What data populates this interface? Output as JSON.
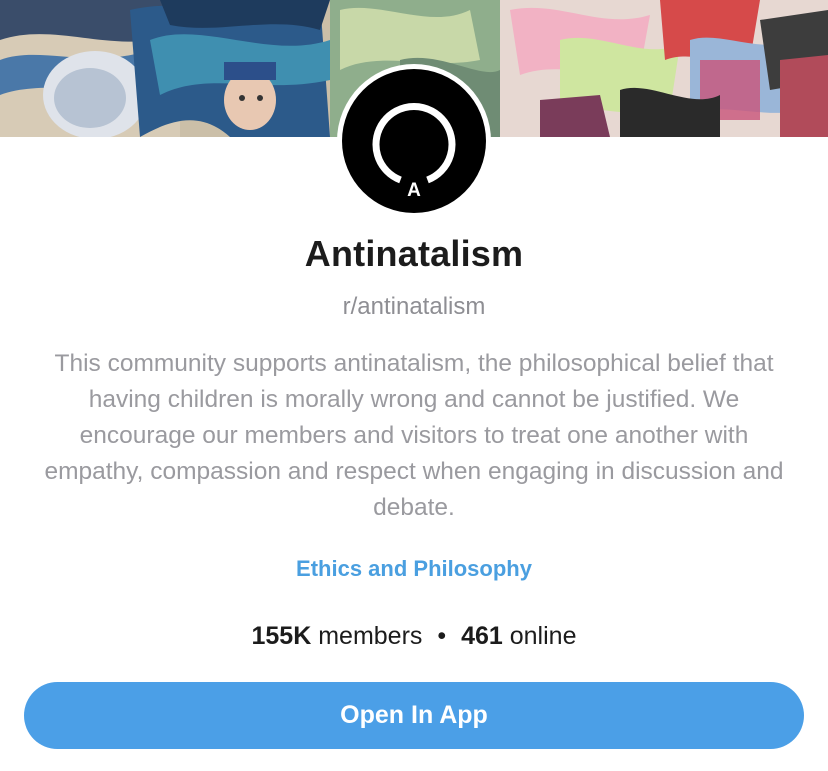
{
  "community": {
    "name": "Antinatalism",
    "handle": "r/antinatalism",
    "avatar_letter": "A",
    "description": "This community supports antinatalism, the philosophical belief that having children is morally wrong and cannot be justified. We encourage our members and visitors to treat one another with empathy, compassion and respect when engaging in discussion and debate.",
    "category": "Ethics and Philosophy",
    "members_count": "155K",
    "members_label": "members",
    "separator": "•",
    "online_count": "461",
    "online_label": "online"
  },
  "actions": {
    "open_in_app_label": "Open In App"
  },
  "colors": {
    "accent": "#4b9fe7",
    "category_link": "#4a9fe0",
    "title_text": "#1c1c1c",
    "muted_text": "#9a9a9f"
  },
  "icons": {
    "avatar": "community-ring-logo-icon"
  }
}
